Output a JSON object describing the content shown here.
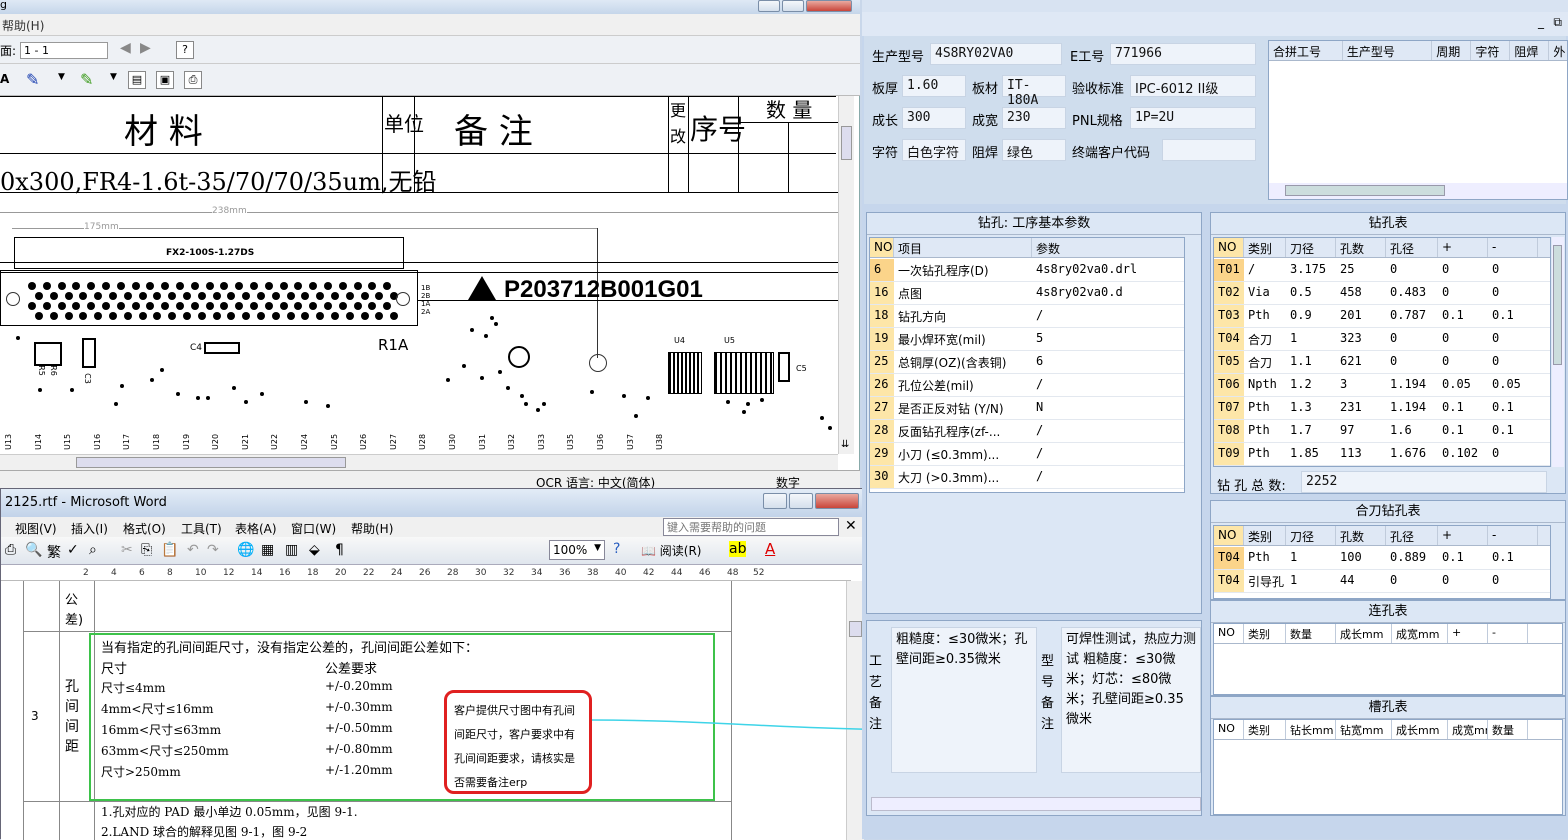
{
  "viewer": {
    "title_fragment": "g",
    "menu": "帮助(H)",
    "page_label": "面:",
    "page_value": "1 - 1",
    "table_header": {
      "material": "材   料",
      "unit": "单位",
      "remark": "备        注",
      "change": "更改",
      "seq": "序号",
      "qty": "数 量"
    },
    "material_row": "0x300,FR4-1.6t-35/70/70/35um,无铅",
    "dim_238": "238mm",
    "dim_175": "175mm",
    "connector": "FX2-100S-1.27DS",
    "pin_labels": [
      "1B",
      "2B",
      "1A",
      "2A"
    ],
    "part_no": "P203712B001G01",
    "labels": {
      "r1a": "R1A",
      "c4": "C4",
      "r5": "R5",
      "r6": "R6",
      "c3": "C3",
      "u4": "U4",
      "u5": "U5",
      "c5": "C5"
    },
    "u_labels": [
      "U13",
      "U14",
      "U15",
      "U16",
      "U17",
      "U18",
      "U19",
      "U20",
      "U21",
      "U22",
      "U24",
      "U25",
      "U26",
      "U27",
      "U28",
      "U30",
      "U31",
      "U32",
      "U33",
      "U35",
      "U36",
      "U37",
      "U38"
    ],
    "status_ocr": "OCR 语言: 中文(简体)",
    "status_num": "数字"
  },
  "word": {
    "title": "2125.rtf - Microsoft Word",
    "menu": [
      "视图(V)",
      "插入(I)",
      "格式(O)",
      "工具(T)",
      "表格(A)",
      "窗口(W)",
      "帮助(H)"
    ],
    "help_placeholder": "键入需要帮助的问题",
    "zoom": "100%",
    "read_btn": "阅读(R)",
    "ruler": [
      "2",
      "4",
      "6",
      "8",
      "10",
      "12",
      "14",
      "16",
      "18",
      "20",
      "22",
      "24",
      "26",
      "28",
      "30",
      "32",
      "34",
      "36",
      "38",
      "40",
      "42",
      "44",
      "46",
      "48",
      "52"
    ],
    "row_prev_label": "公差)",
    "row_num": "3",
    "row_label": "孔间间距",
    "intro": "当有指定的孔间间距尺寸，没有指定公差的，孔间间距公差如下：",
    "col_size": "尺寸",
    "col_tol": "公差要求",
    "rows": [
      {
        "size": "尺寸≤4mm",
        "tol": "+/-0.20mm"
      },
      {
        "size": "4mm<尺寸≤16mm",
        "tol": "+/-0.30mm"
      },
      {
        "size": "16mm<尺寸≤63mm",
        "tol": "+/-0.50mm"
      },
      {
        "size": "63mm<尺寸≤250mm",
        "tol": "+/-0.80mm"
      },
      {
        "size": "尺寸>250mm",
        "tol": "+/-1.20mm"
      }
    ],
    "next_1": "1.孔对应的 PAD 最小单边 0.05mm，见图 9-1.",
    "next_2": "2.LAND 球合的解释见图 9-1，图 9-2"
  },
  "callout": "客户提供尺寸图中有孔间间距尺寸，客户要求中有孔间间距要求，请核实是否需要备注erp",
  "app": {
    "prod_model_label": "生产型号",
    "prod_model": "4S8RY02VA0",
    "e_no_label": "E工号",
    "e_no": "771966",
    "thick_label": "板厚",
    "thick": "1.60",
    "mat_label": "板材",
    "mat": "IT-180A",
    "std_label": "验收标准",
    "std": "IPC-6012 II级",
    "len_label": "成长",
    "len": "300",
    "wid_label": "成宽",
    "wid": "230",
    "pnl_label": "PNL规格",
    "pnl": "1P=2U",
    "char_label": "字符",
    "char": "白色字符",
    "mask_label": "阻焊",
    "mask": "绿色",
    "cust_label": "终端客户代码",
    "cust": "",
    "merge_cols": [
      "合拼工号",
      "生产型号",
      "周期",
      "字符",
      "阻焊",
      "外"
    ],
    "drill_param_title": "钻孔: 工序基本参数",
    "drill_param_cols": [
      "NO",
      "项目",
      "参数"
    ],
    "drill_params": [
      {
        "no": "6",
        "item": "一次钻孔程序(D)",
        "val": "4s8ry02va0.drl"
      },
      {
        "no": "16",
        "item": "点图",
        "val": "4s8ry02va0.d"
      },
      {
        "no": "18",
        "item": "钻孔方向",
        "val": "/"
      },
      {
        "no": "19",
        "item": "最小焊环宽(mil)",
        "val": "5"
      },
      {
        "no": "25",
        "item": "总铜厚(OZ)(含表铜)",
        "val": "6"
      },
      {
        "no": "26",
        "item": "孔位公差(mil)",
        "val": "/"
      },
      {
        "no": "27",
        "item": "是否正反对钻 (Y/N)",
        "val": "N"
      },
      {
        "no": "28",
        "item": "反面钻孔程序(zf-...",
        "val": "/"
      },
      {
        "no": "29",
        "item": "小刀 (≤0.3mm)...",
        "val": "/"
      },
      {
        "no": "30",
        "item": "大刀 (>0.3mm)...",
        "val": "/"
      }
    ],
    "hole_title": "钻孔表",
    "hole_cols": [
      "NO",
      "类别",
      "刀径",
      "孔数",
      "孔径",
      "+",
      "-"
    ],
    "holes": [
      [
        "T01",
        "/",
        "3.175",
        "25",
        "0",
        "0",
        "0"
      ],
      [
        "T02",
        "Via",
        "0.5",
        "458",
        "0.483",
        "0",
        "0"
      ],
      [
        "T03",
        "Pth",
        "0.9",
        "201",
        "0.787",
        "0.1",
        "0.1"
      ],
      [
        "T04",
        "合刀",
        "1",
        "323",
        "0",
        "0",
        "0"
      ],
      [
        "T05",
        "合刀",
        "1.1",
        "621",
        "0",
        "0",
        "0"
      ],
      [
        "T06",
        "Npth",
        "1.2",
        "3",
        "1.194",
        "0.05",
        "0.05"
      ],
      [
        "T07",
        "Pth",
        "1.3",
        "231",
        "1.194",
        "0.1",
        "0.1"
      ],
      [
        "T08",
        "Pth",
        "1.7",
        "97",
        "1.6",
        "0.1",
        "0.1"
      ],
      [
        "T09",
        "Pth",
        "1.85",
        "113",
        "1.676",
        "0.102",
        "0"
      ]
    ],
    "total_label": "钻 孔 总 数:",
    "total": "2252",
    "merge_hole_title": "合刀钻孔表",
    "merge_holes": [
      [
        "T04",
        "Pth",
        "1",
        "100",
        "0.889",
        "0.1",
        "0.1"
      ],
      [
        "T04",
        "引导孔",
        "1",
        "44",
        "0",
        "0",
        "0"
      ]
    ],
    "slot_chain_title": "连孔表",
    "slot_chain_cols": [
      "NO",
      "类别",
      "数量",
      "成长mm",
      "成宽mm",
      "+",
      "-"
    ],
    "slot_title": "槽孔表",
    "slot_cols": [
      "NO",
      "类别",
      "钻长mm",
      "钻宽mm",
      "成长mm",
      "成宽mm",
      "数量"
    ],
    "craft_label": "工艺备注",
    "craft_text": "粗糙度：≤30微米；孔壁间距≥0.35微米",
    "model_label": "型号备注",
    "model_text": "可焊性测试，热应力测试 粗糙度：≤30微米；灯芯：≤80微米；孔壁间距≥0.35微米"
  }
}
